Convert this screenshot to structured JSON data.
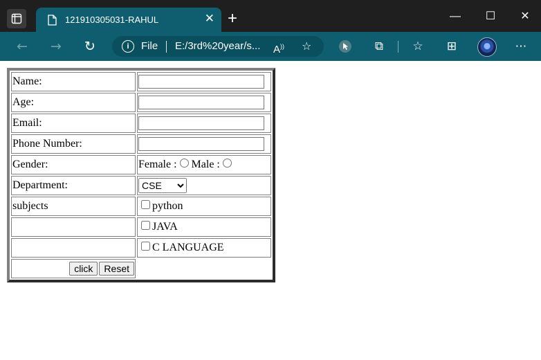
{
  "browser": {
    "tab_title": "121910305031-RAHUL",
    "address_protocol_label": "File",
    "address_url": "E:/3rd%20year/s...",
    "icons": {
      "tab_actions": "tab-actions-icon",
      "page": "page-icon",
      "close": "close-icon",
      "new_tab": "plus-icon",
      "back": "back-arrow-icon",
      "forward": "forward-arrow-icon",
      "refresh": "refresh-icon",
      "info": "info-icon",
      "read_aloud": "read-aloud-icon",
      "add_favorite": "add-favorite-icon",
      "extension_pointer": "extension-icon",
      "extensions": "puzzle-icon",
      "favorites": "favorites-icon",
      "collections": "collections-icon",
      "profile": "profile-avatar",
      "more": "more-icon"
    },
    "window_controls": {
      "minimize": "—",
      "maximize": "☐",
      "close": "✕"
    },
    "colors": {
      "titlebar": "#1f1f1f",
      "toolbar": "#0e5e6f"
    }
  },
  "form": {
    "name_label": "Name:",
    "age_label": "Age:",
    "email_label": "Email:",
    "phone_label": "Phone Number:",
    "gender_label": "Gender:",
    "female_label": "Female :",
    "male_label": "Male :",
    "department_label": "Department:",
    "department_selected": "CSE",
    "subjects_label": "subjects",
    "subject_options": [
      "python",
      "JAVA",
      "C LANGUAGE"
    ],
    "submit_label": "click",
    "reset_label": "Reset"
  }
}
